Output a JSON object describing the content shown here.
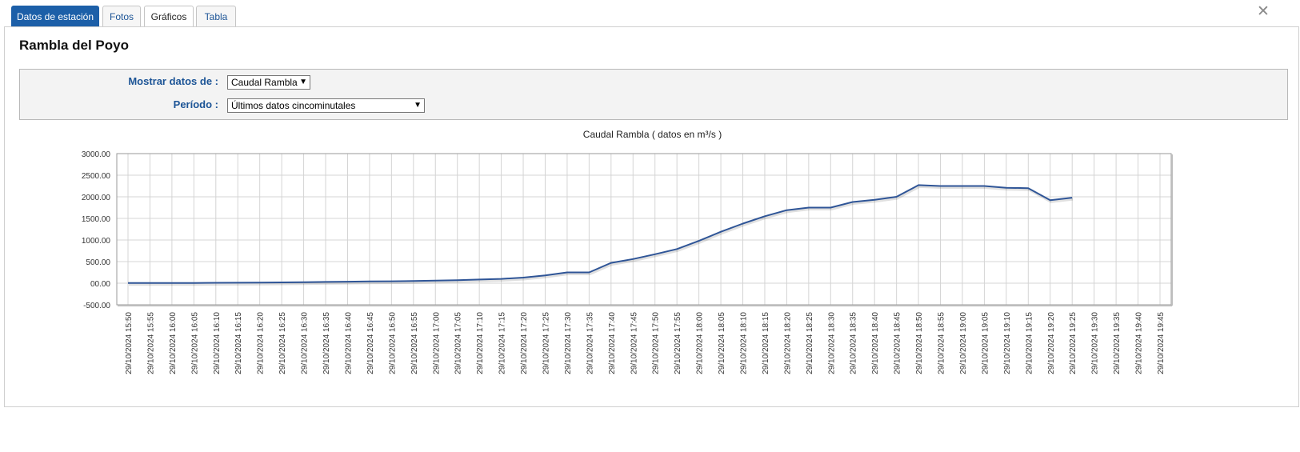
{
  "tabs": [
    {
      "label": "Datos de estación",
      "state": "primary"
    },
    {
      "label": "Fotos",
      "state": "default"
    },
    {
      "label": "Gráficos",
      "state": "selected"
    },
    {
      "label": "Tabla",
      "state": "default"
    }
  ],
  "station": {
    "name": "Rambla del Poyo"
  },
  "filters": {
    "mostrar_label": "Mostrar datos de :",
    "mostrar_value": "Caudal Rambla",
    "periodo_label": "Período :",
    "periodo_value": "Últimos datos cincominutales"
  },
  "colors": {
    "line": "#2f5597",
    "accent": "#1c5fa8",
    "label": "#1c5496"
  },
  "icons": {
    "close": "close-icon",
    "dropdown": "chevron-down-icon"
  },
  "chart_data": {
    "type": "line",
    "title": "Caudal Rambla ( datos en m³/s )",
    "xlabel": "",
    "ylabel": "",
    "ylim": [
      -500,
      3000
    ],
    "yticks": [
      "3000.00",
      "2500.00",
      "2000.00",
      "1500.00",
      "1000.00",
      "500.00",
      "00.00",
      "-500.00"
    ],
    "grid": true,
    "categories": [
      "29/10/2024 15:50",
      "29/10/2024 15:55",
      "29/10/2024 16:00",
      "29/10/2024 16:05",
      "29/10/2024 16:10",
      "29/10/2024 16:15",
      "29/10/2024 16:20",
      "29/10/2024 16:25",
      "29/10/2024 16:30",
      "29/10/2024 16:35",
      "29/10/2024 16:40",
      "29/10/2024 16:45",
      "29/10/2024 16:50",
      "29/10/2024 16:55",
      "29/10/2024 17:00",
      "29/10/2024 17:05",
      "29/10/2024 17:10",
      "29/10/2024 17:15",
      "29/10/2024 17:20",
      "29/10/2024 17:25",
      "29/10/2024 17:30",
      "29/10/2024 17:35",
      "29/10/2024 17:40",
      "29/10/2024 17:45",
      "29/10/2024 17:50",
      "29/10/2024 17:55",
      "29/10/2024 18:00",
      "29/10/2024 18:05",
      "29/10/2024 18:10",
      "29/10/2024 18:15",
      "29/10/2024 18:20",
      "29/10/2024 18:25",
      "29/10/2024 18:30",
      "29/10/2024 18:35",
      "29/10/2024 18:40",
      "29/10/2024 18:45",
      "29/10/2024 18:50",
      "29/10/2024 18:55",
      "29/10/2024 19:00",
      "29/10/2024 19:05",
      "29/10/2024 19:10",
      "29/10/2024 19:15",
      "29/10/2024 19:20",
      "29/10/2024 19:25",
      "29/10/2024 19:30",
      "29/10/2024 19:35",
      "29/10/2024 19:40",
      "29/10/2024 19:45"
    ],
    "series": [
      {
        "values": [
          5,
          5,
          5,
          5,
          10,
          12,
          15,
          18,
          22,
          30,
          35,
          40,
          45,
          50,
          60,
          70,
          85,
          100,
          130,
          180,
          250,
          250,
          470,
          560,
          670,
          790,
          980,
          1190,
          1380,
          1550,
          1690,
          1750,
          1750,
          1880,
          1930,
          2000,
          2270,
          2250,
          2250,
          2250,
          2210,
          2200,
          1920,
          1980,
          null,
          null,
          null,
          null
        ]
      }
    ]
  }
}
